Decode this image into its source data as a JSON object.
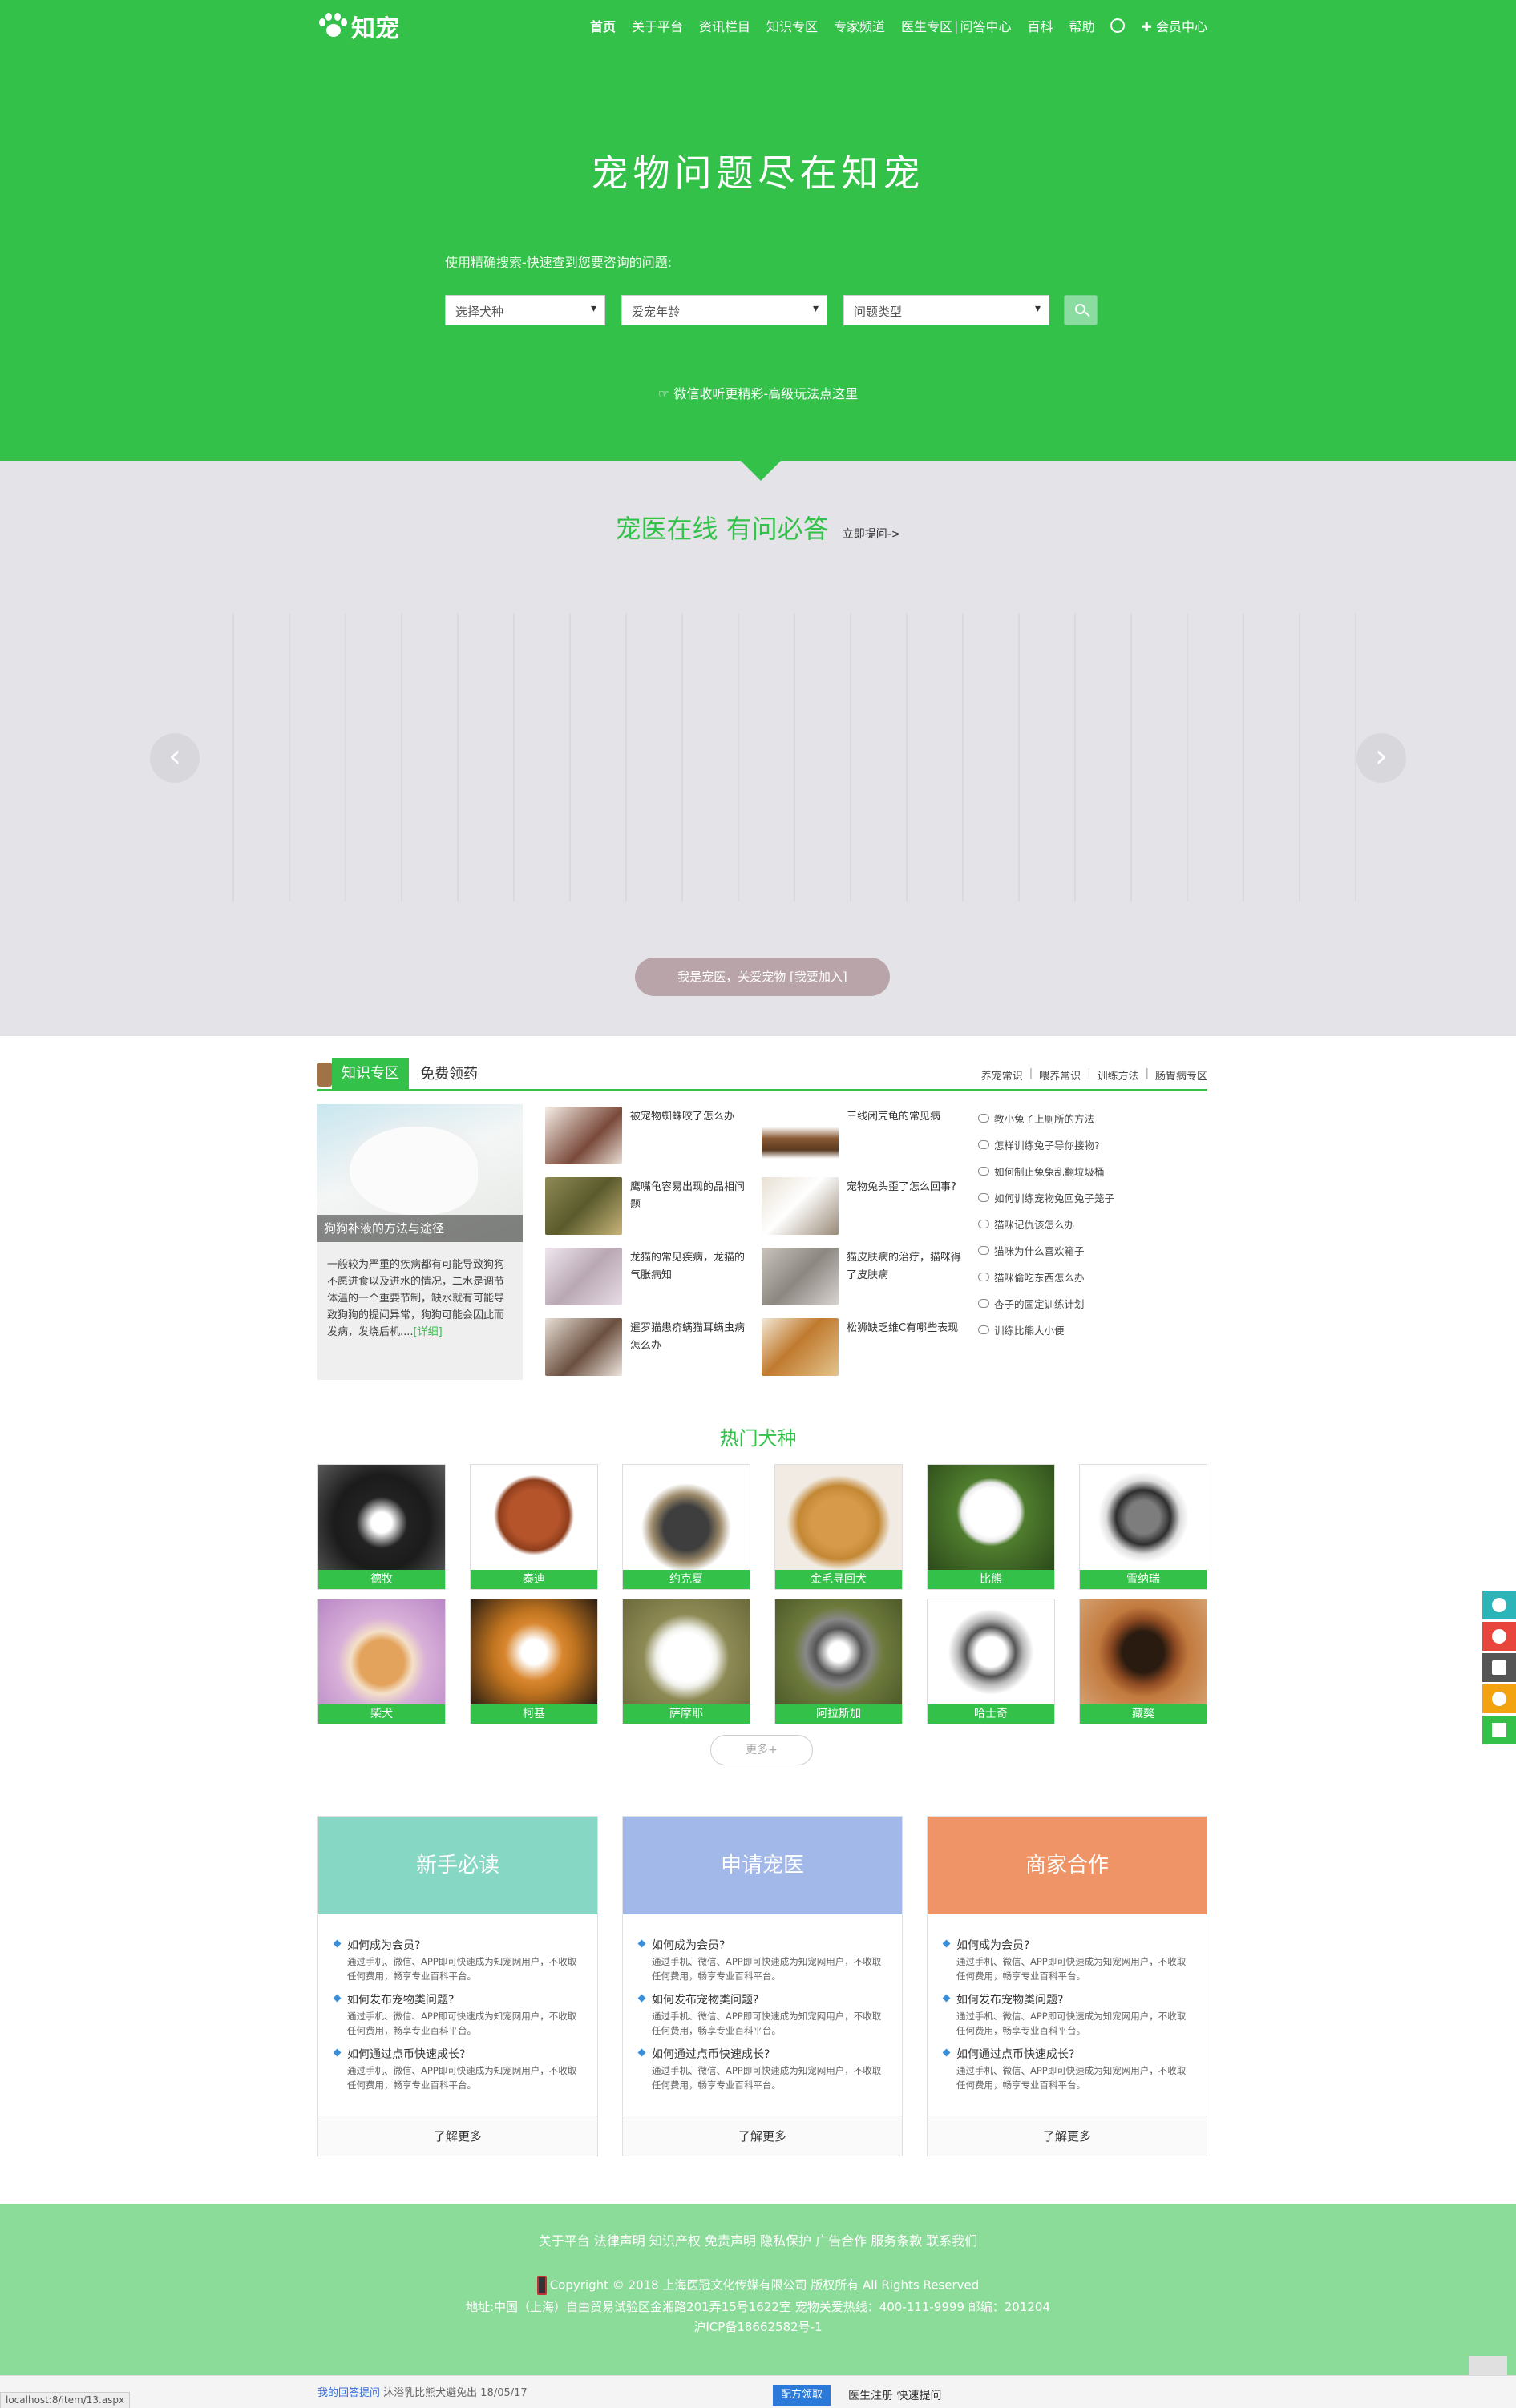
{
  "nav": {
    "logo": "知宠",
    "items": [
      "首页",
      "关于平台",
      "资讯栏目",
      "知识专区",
      "专家频道",
      "医生专区",
      "问答中心",
      "百科",
      "帮助"
    ],
    "member": "会员中心"
  },
  "hero": {
    "slogan": "宠物问题尽在知宠",
    "search_hint": "使用精确搜索-快速查到您要咨询的问题:",
    "select_breed": "选择犬种",
    "select_age": "爱宠年龄",
    "select_type": "问题类型",
    "wechat_tip": "微信收听更精彩-高级玩法点这里"
  },
  "vet": {
    "title": "宠医在线 有问必答",
    "ask_link": "立即提问->",
    "join_button": "我是宠医，关爱宠物 [我要加入]"
  },
  "knowledge": {
    "tab": "知识专区",
    "free": "免费领药",
    "links": [
      "养宠常识",
      "喂养常识",
      "训练方法",
      "肠胃病专区"
    ],
    "feature_caption": "狗狗补液的方法与途径",
    "feature_desc": "一般较为严重的疾病都有可能导致狗狗不愿进食以及进水的情况，二水是调节体温的一个重要节制，缺水就有可能导致狗狗的提问异常，狗狗可能会因此而发病，发烧后机....",
    "feature_more": "[详细]",
    "news": [
      "被宠物蜘蛛咬了怎么办",
      "三线闭壳龟的常见病",
      "鹰嘴龟容易出现的品相问题",
      "宠物兔头歪了怎么回事?",
      "龙猫的常见疾病，龙猫的气胀病知",
      "猫皮肤病的治疗，猫咪得了皮肤病",
      "暹罗猫患疥螨猫耳螨虫病怎么办",
      "松狮缺乏维C有哪些表现"
    ],
    "qa": [
      "教小兔子上厕所的方法",
      "怎样训练兔子导你接物?",
      "如何制止兔兔乱翻垃圾桶",
      "如何训练宠物兔回兔子笼子",
      "猫咪记仇该怎么办",
      "猫咪为什么喜欢箱子",
      "猫咪偷吃东西怎么办",
      "杏子的固定训练计划",
      "训练比熊大小便"
    ]
  },
  "breeds": {
    "title": "热门犬种",
    "items": [
      "德牧",
      "泰迪",
      "约克夏",
      "金毛寻回犬",
      "比熊",
      "雪纳瑞",
      "柴犬",
      "柯基",
      "萨摩耶",
      "阿拉斯加",
      "哈士奇",
      "藏獒"
    ],
    "more": "更多+"
  },
  "cards": [
    {
      "title": "新手必读",
      "color": "#86d7c4"
    },
    {
      "title": "申请宠医",
      "color": "#a2b8e8"
    },
    {
      "title": "商家合作",
      "color": "#ee9467"
    }
  ],
  "card_qa": {
    "q1": "如何成为会员?",
    "q2": "如何发布宠物类问题?",
    "q3": "如何通过点币快速成长?",
    "answer": "通过手机、微信、APP即可快速成为知宠网用户，不收取任何费用，畅享专业百科平台。",
    "more": "了解更多"
  },
  "footer": {
    "links": "关于平台 法律声明 知识产权 免责声明 隐私保护 广告合作 服务条款 联系我们",
    "copyright": "Copyright © 2018 上海医冠文化传媒有限公司 版权所有 All Rights Reserved",
    "address": "地址:中国（上海）自由贸易试验区金湘路201弄15号1622室     宠物关爱热线：400-111-9999     邮编：201204",
    "icp": "沪ICP备18662582号-1"
  },
  "bottom": {
    "status_url": "localhost:8/item/13.aspx",
    "ticker_link": "我的回答提问",
    "ticker": "沐浴乳比熊犬避免出 18/05/17",
    "button": "配方领取",
    "text": "医生注册 快速提问"
  },
  "colors": {
    "brand_green": "#33c14a",
    "footer_green": "#8bdb99",
    "vet_bg": "#e3e3e8"
  }
}
